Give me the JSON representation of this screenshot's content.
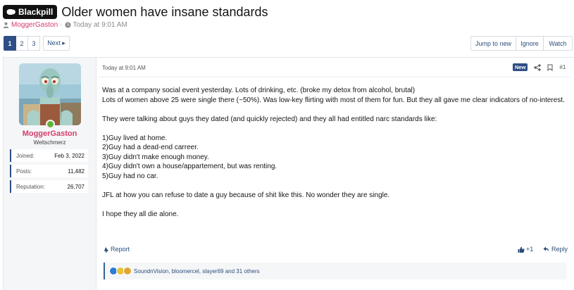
{
  "thread": {
    "prefix": "Blackpill",
    "title": "Older women have insane standards",
    "author": "MoggerGaston",
    "separator": "·",
    "date": "Today at 9:01 AM"
  },
  "pagination": {
    "pages": [
      "1",
      "2",
      "3"
    ],
    "current": "1",
    "next_label": "Next ▸"
  },
  "thread_actions": {
    "jump_label": "Jump to new",
    "ignore_label": "Ignore",
    "watch_label": "Watch"
  },
  "user": {
    "name": "MoggerGaston",
    "title": "Weltschmerz",
    "stats": [
      {
        "key": "Joined:",
        "value": "Feb 3, 2022"
      },
      {
        "key": "Posts:",
        "value": "11,482"
      },
      {
        "key": "Reputation:",
        "value": "26,707"
      }
    ]
  },
  "post": {
    "date": "Today at 9:01 AM",
    "new_badge": "New",
    "number": "#1",
    "paragraphs": [
      [
        "Was at a company social event yesterday. Lots of drinking, etc. (broke my detox from alcohol, brutal)",
        "Lots of women above 25 were single there (~50%). Was low-key flirting with most of them for fun. But they all gave me clear indicators of no-interest."
      ],
      [
        "They were talking about guys they dated (and quickly rejected) and they all had entitled narc standards like:"
      ],
      [
        "1)Guy lived at home.",
        "2)Guy had a dead-end carreer.",
        "3)Guy didn't make enough money.",
        "4)Guy didn't own a house/appartement, but was renting.",
        "5)Guy had no car."
      ],
      [
        "JFL at how you can refuse to date a guy because of shit like this. No wonder they are single."
      ],
      [
        "I hope they all die alone."
      ]
    ],
    "report_label": "Report",
    "react_label": "+1",
    "reply_label": "Reply",
    "reactions_text": "SoundnVision, bloomercel, slayer69 and 31 others"
  },
  "colors": {
    "accent": "#2f4e86",
    "username": "#d53c6b",
    "online": "#63b33f"
  }
}
